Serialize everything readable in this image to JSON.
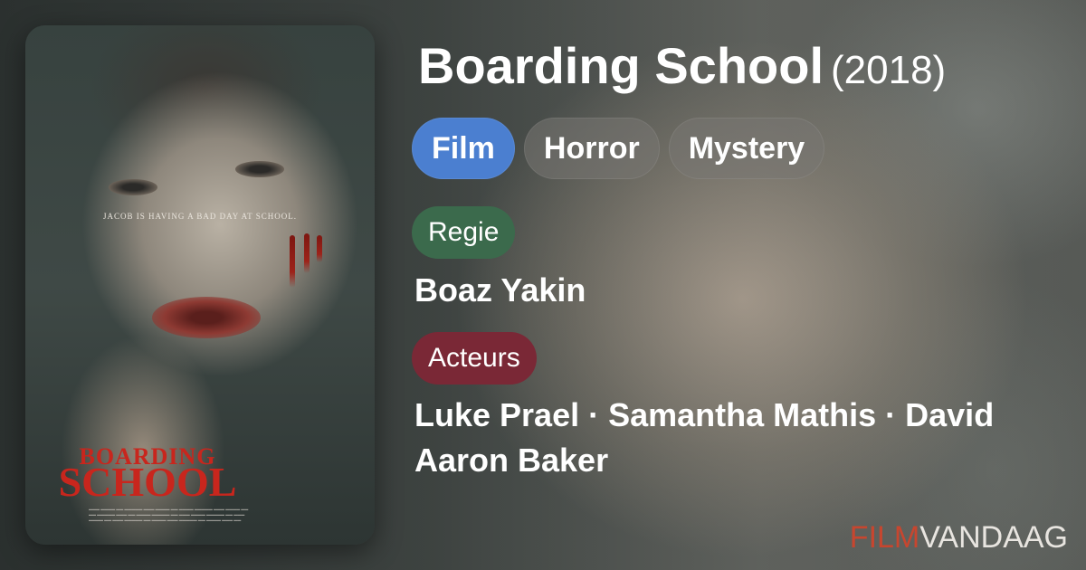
{
  "poster": {
    "tagline": "JACOB IS HAVING A BAD DAY AT SCHOOL.",
    "title_line1": "BOARDING",
    "title_line2": "SCHOOL"
  },
  "movie": {
    "title": "Boarding School",
    "year": "(2018)"
  },
  "genres": [
    "Film",
    "Horror",
    "Mystery"
  ],
  "labels": {
    "director": "Regie",
    "actors": "Acteurs"
  },
  "director": "Boaz Yakin",
  "actors": "Luke Prael · Samantha Mathis · David Aaron Baker",
  "brand": {
    "part1": "FILM",
    "part2": "VANDAAG"
  },
  "colors": {
    "primary_chip": "#4b7fd0",
    "director_label": "#3b6a4c",
    "actors_label": "#7a2836",
    "brand_accent": "#c7462f"
  }
}
